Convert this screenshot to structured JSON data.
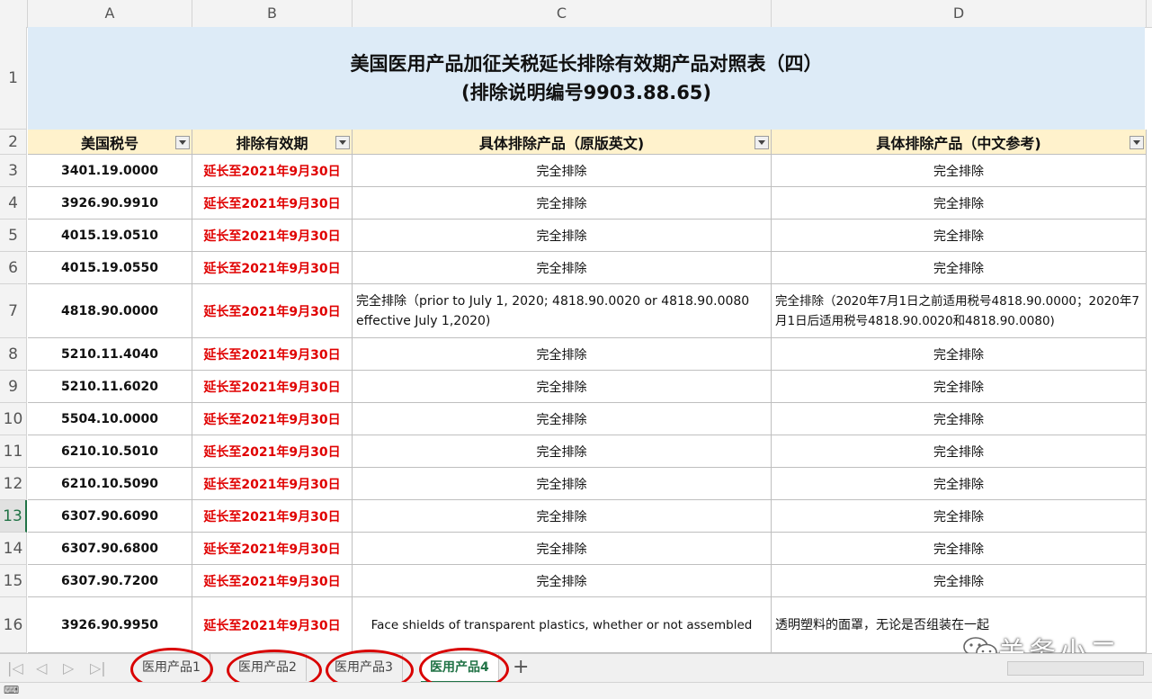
{
  "columns": [
    "A",
    "B",
    "C",
    "D"
  ],
  "title": {
    "line1": "美国医用产品加征关税延长排除有效期产品对照表（四）",
    "line2": "(排除说明编号9903.88.65)"
  },
  "headers": {
    "code": "美国税号",
    "validity": "排除有效期",
    "english": "具体排除产品（原版英文)",
    "chinese": "具体排除产品（中文参考)"
  },
  "row_numbers": [
    "1",
    "2",
    "3",
    "4",
    "5",
    "6",
    "7",
    "8",
    "9",
    "10",
    "11",
    "12",
    "13",
    "14",
    "15",
    "16"
  ],
  "rows": [
    {
      "code": "3401.19.0000",
      "date": "延长至2021年9月30日",
      "english": "完全排除",
      "chinese": "完全排除"
    },
    {
      "code": "3926.90.9910",
      "date": "延长至2021年9月30日",
      "english": "完全排除",
      "chinese": "完全排除"
    },
    {
      "code": "4015.19.0510",
      "date": "延长至2021年9月30日",
      "english": "完全排除",
      "chinese": "完全排除"
    },
    {
      "code": "4015.19.0550",
      "date": "延长至2021年9月30日",
      "english": "完全排除",
      "chinese": "完全排除"
    },
    {
      "code": "4818.90.0000",
      "date": "延长至2021年9月30日",
      "english": "完全排除（prior to July 1, 2020; 4818.90.0020 or 4818.90.0080 effective July 1,2020)",
      "chinese": "完全排除（2020年7月1日之前适用税号4818.90.0000；2020年7月1日后适用税号4818.90.0020和4818.90.0080)"
    },
    {
      "code": "5210.11.4040",
      "date": "延长至2021年9月30日",
      "english": "完全排除",
      "chinese": "完全排除"
    },
    {
      "code": "5210.11.6020",
      "date": "延长至2021年9月30日",
      "english": "完全排除",
      "chinese": "完全排除"
    },
    {
      "code": "5504.10.0000",
      "date": "延长至2021年9月30日",
      "english": "完全排除",
      "chinese": "完全排除"
    },
    {
      "code": "6210.10.5010",
      "date": "延长至2021年9月30日",
      "english": "完全排除",
      "chinese": "完全排除"
    },
    {
      "code": "6210.10.5090",
      "date": "延长至2021年9月30日",
      "english": "完全排除",
      "chinese": "完全排除"
    },
    {
      "code": "6307.90.6090",
      "date": "延长至2021年9月30日",
      "english": "完全排除",
      "chinese": "完全排除"
    },
    {
      "code": "6307.90.6800",
      "date": "延长至2021年9月30日",
      "english": "完全排除",
      "chinese": "完全排除"
    },
    {
      "code": "6307.90.7200",
      "date": "延长至2021年9月30日",
      "english": "完全排除",
      "chinese": "完全排除"
    },
    {
      "code": "3926.90.9950",
      "date": "延长至2021年9月30日",
      "english": "Face shields of transparent plastics, whether or not assembled",
      "chinese": "透明塑料的面罩，无论是否组装在一起"
    }
  ],
  "sheet_tabs": [
    "医用产品1",
    "医用产品2",
    "医用产品3",
    "医用产品4"
  ],
  "active_tab": "医用产品4",
  "active_row": "13",
  "watermark": "关务小二",
  "colors": {
    "accent": "#217346",
    "date_red": "#e00000",
    "title_bg": "#ddebf7",
    "header_bg": "#fff2cc",
    "circle": "#d90000"
  }
}
